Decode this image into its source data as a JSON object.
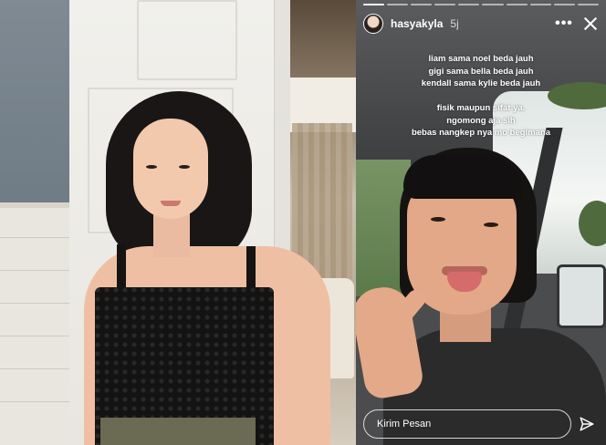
{
  "story": {
    "username": "hasyakyla",
    "time": "5j",
    "more_label": "•••",
    "caption_lines_1": [
      "liam sama noel beda jauh",
      "gigi sama bella beda jauh",
      "kendall sama kylie beda jauh"
    ],
    "caption_lines_2": [
      "fisik maupun sifat ya.",
      "ngomong aja sih",
      "bebas nangkep nya mo begimana"
    ],
    "reply_placeholder": "Kirim Pesan",
    "progress_segments": 10,
    "active_segment": 0
  },
  "icons": {
    "more": "more-horizontal-icon",
    "close": "close-icon",
    "send": "send-icon"
  },
  "colors": {
    "text": "#ffffff",
    "story_bg": "#4b4c4d"
  }
}
